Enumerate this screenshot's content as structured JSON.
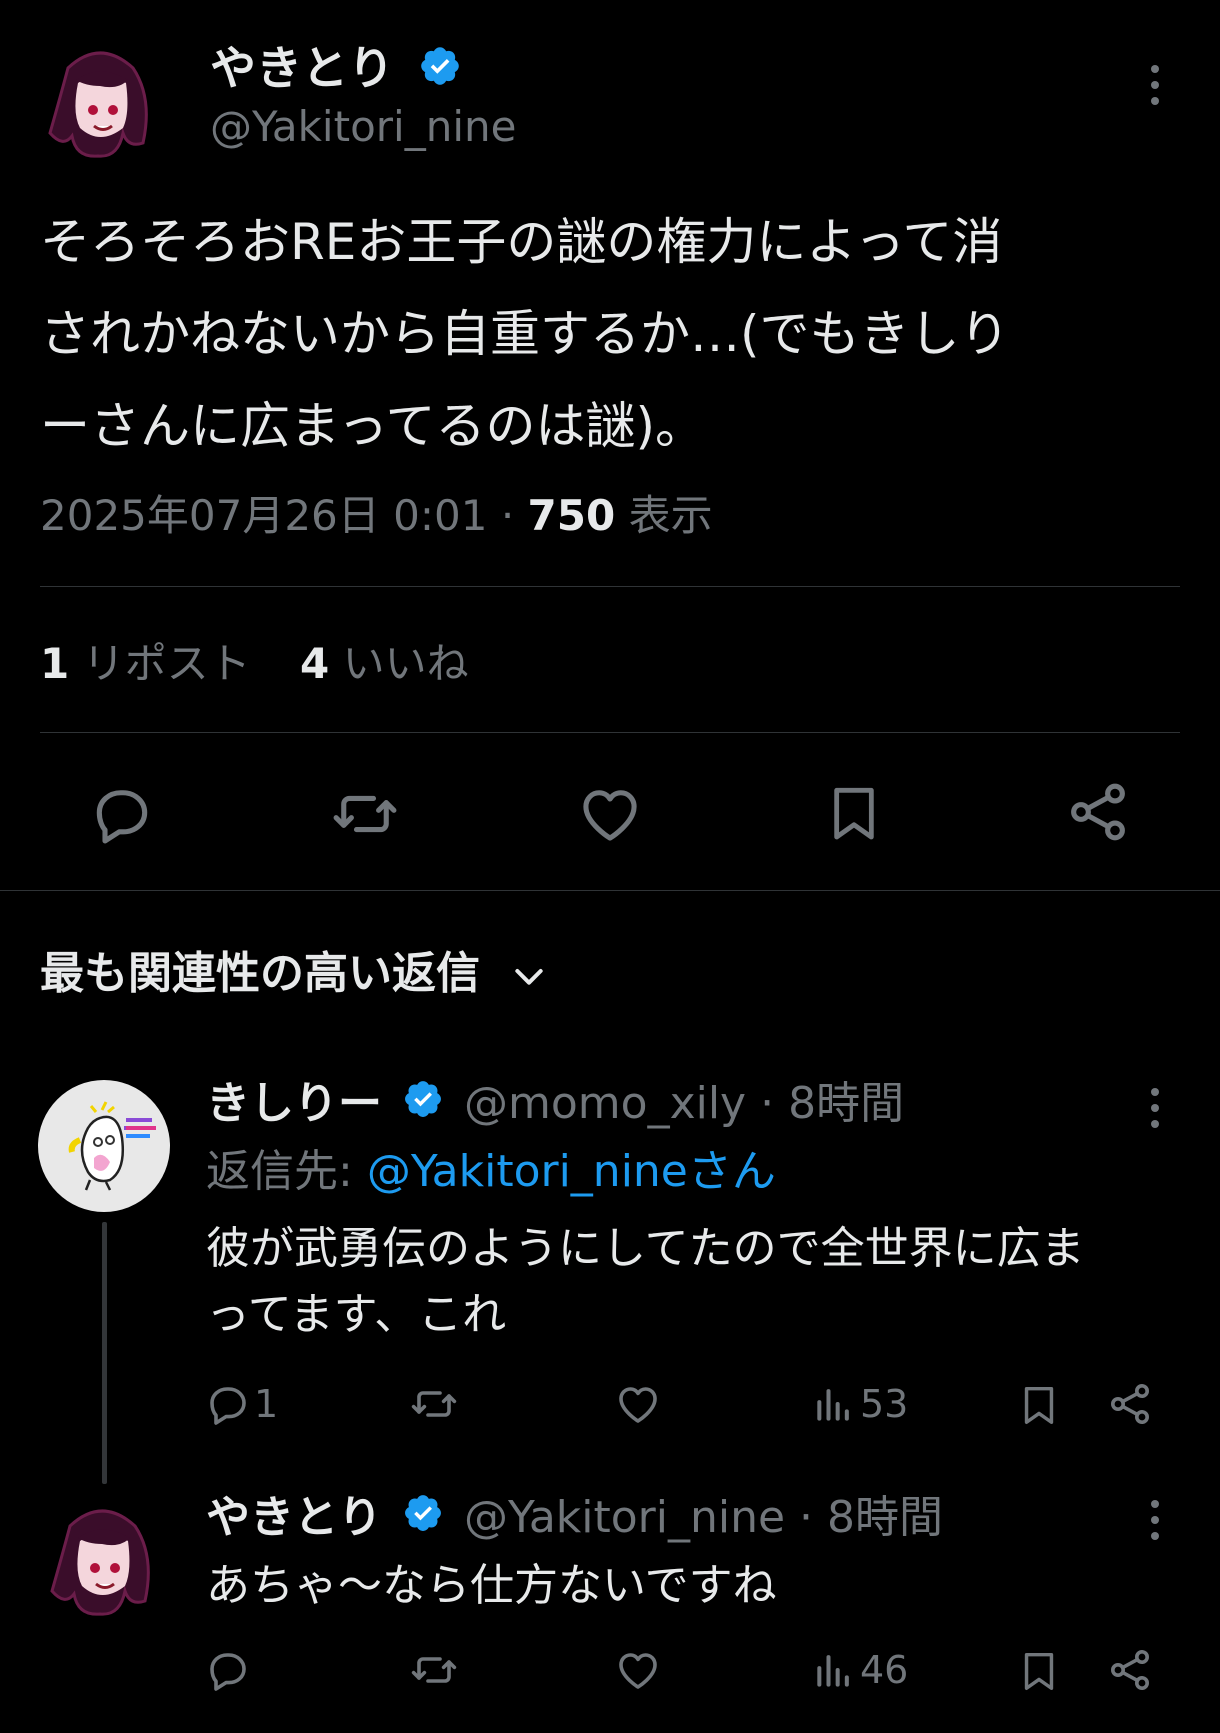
{
  "main_tweet": {
    "display_name": "やきとり",
    "handle": "@Yakitori_nine",
    "text_lines": [
      "そろそろおREお王子の謎の権力によって消",
      "されかねないから自重するか…(でもきしり",
      "ーさんに広まってるのは謎)。"
    ],
    "timestamp": "2025年07月26日 0:01",
    "separator": "·",
    "views": "750",
    "views_label": "表示",
    "reposts": "1",
    "reposts_label": "リポスト",
    "likes": "4",
    "likes_label": "いいね"
  },
  "replies_header": {
    "label": "最も関連性の高い返信"
  },
  "replies": [
    {
      "display_name": "きしりー",
      "handle": "@momo_xily",
      "sep": "·",
      "time": "8時間",
      "reply_to_label": "返信先:",
      "reply_to_handle": "@Yakitori_nineさん",
      "text_lines": [
        "彼が武勇伝のようにしてたので全世界に広ま",
        "ってます、これ"
      ],
      "reply_count": "1",
      "views": "53"
    },
    {
      "display_name": "やきとり",
      "handle": "@Yakitori_nine",
      "sep": "·",
      "time": "8時間",
      "text_lines": [
        "あちゃ〜なら仕方ないですね"
      ],
      "views": "46"
    }
  ],
  "colors": {
    "background": "#000000",
    "text": "#e7e9ea",
    "muted": "#71767b",
    "accent": "#1d9bf0"
  }
}
